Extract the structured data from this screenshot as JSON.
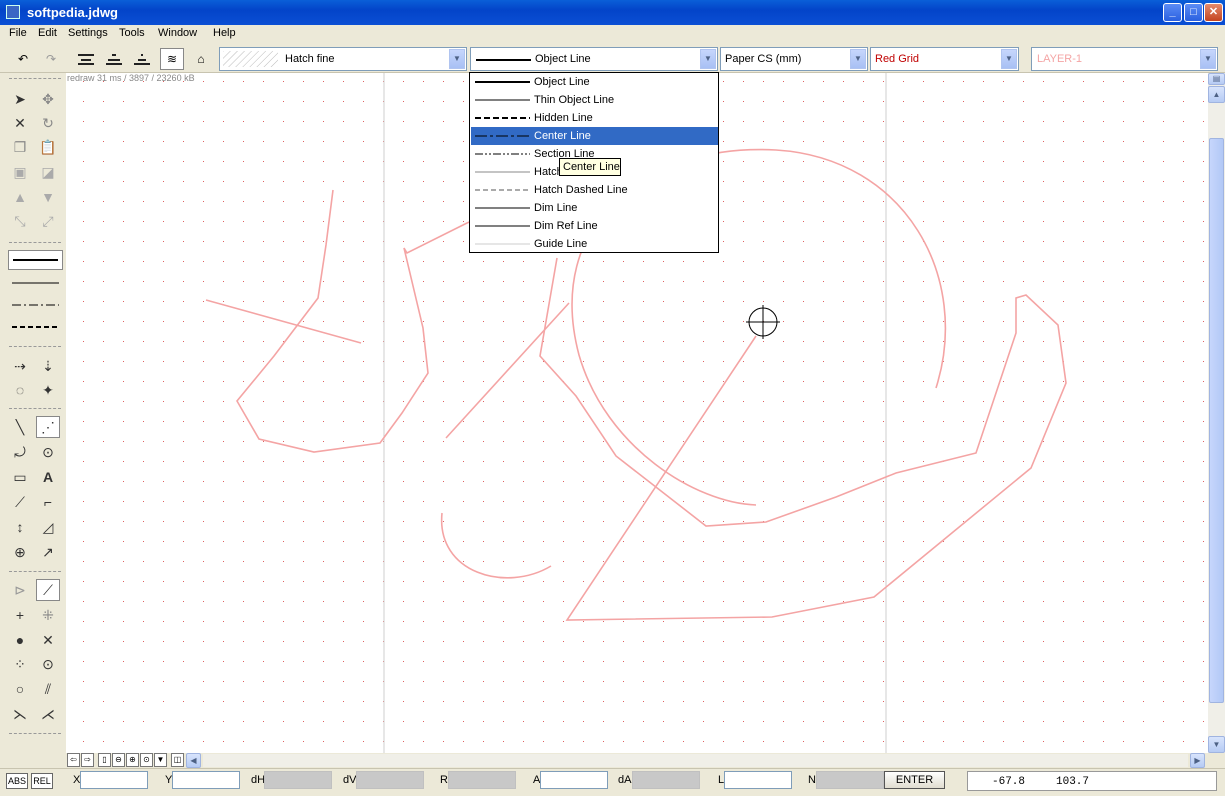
{
  "window": {
    "title": "softpedia.jdwg"
  },
  "menu": [
    "File",
    "Edit",
    "Settings",
    "Tools",
    "Window",
    "Help"
  ],
  "toolbar": {
    "hatch_combo": "Hatch fine",
    "linetype_combo": "Object Line",
    "coord_system_combo": "Paper CS (mm)",
    "grid_combo": "Red Grid",
    "layer_combo": "LAYER-1"
  },
  "canvas": {
    "redraw_info": "redraw 31 ms / 3897 / 23260 kB"
  },
  "linetype_dropdown": {
    "items": [
      "Object Line",
      "Thin Object Line",
      "Hidden Line",
      "Center Line",
      "Section Line",
      "Hatch Line",
      "Hatch Dashed Line",
      "Dim Line",
      "Dim Ref Line",
      "Guide Line"
    ],
    "selected": "Center Line",
    "tooltip": "Center Line"
  },
  "statusbar": {
    "abs": "ABS",
    "rel": "REL",
    "labels": {
      "x": "X",
      "y": "Y",
      "dh": "dH",
      "dv": "dV",
      "r": "R",
      "a": "A",
      "da": "dA",
      "l": "L",
      "n": "N"
    },
    "enter": "ENTER",
    "coord_x": "-67.8",
    "coord_y": "103.7"
  },
  "colors": {
    "drawing": "#f4a4a4",
    "grid_dot": "#e06060",
    "selection": "#316ac5",
    "titlebar": "#0a5fd8"
  }
}
